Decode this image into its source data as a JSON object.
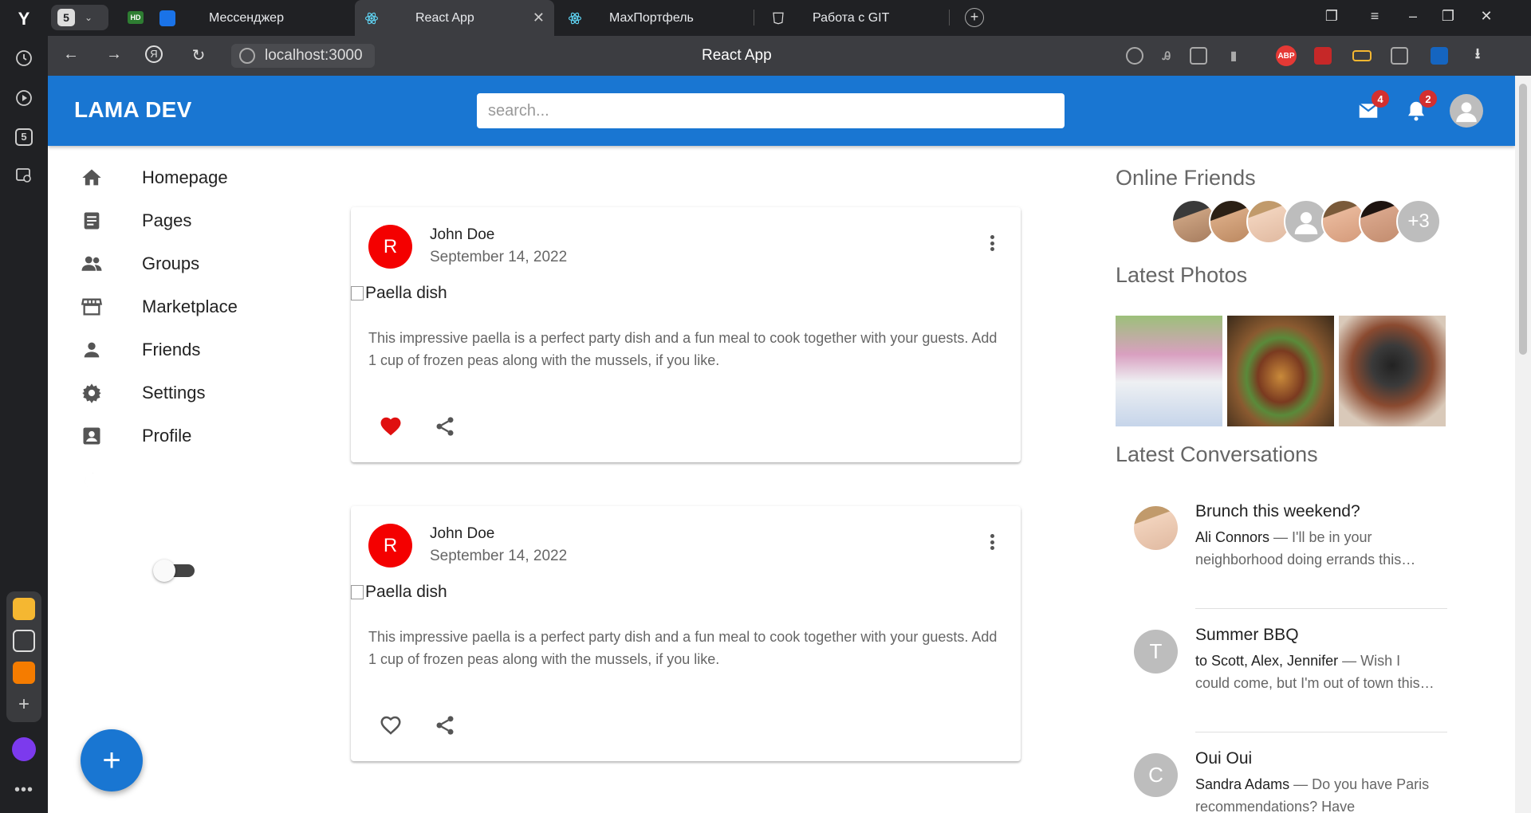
{
  "browser": {
    "rail_logo": "Y",
    "rail_badge": "5",
    "tabs": [
      {
        "label": "Мессенджер"
      },
      {
        "label": "React App",
        "active": true
      },
      {
        "label": "МахПортфель"
      },
      {
        "label": "Работа с GIT"
      }
    ],
    "tab_counter": "5",
    "url": "localhost:3000",
    "page_title": "React App",
    "ext_abp": "ABP"
  },
  "appbar": {
    "brand": "LAMA DEV",
    "search_placeholder": "search...",
    "mail_badge": "4",
    "notif_badge": "2"
  },
  "sidebar": {
    "items": [
      {
        "label": "Homepage",
        "icon": "home-icon"
      },
      {
        "label": "Pages",
        "icon": "article-icon"
      },
      {
        "label": "Groups",
        "icon": "groups-icon"
      },
      {
        "label": "Marketplace",
        "icon": "storefront-icon"
      },
      {
        "label": "Friends",
        "icon": "person-icon"
      },
      {
        "label": "Settings",
        "icon": "settings-icon"
      },
      {
        "label": "Profile",
        "icon": "account-box-icon"
      }
    ],
    "dark_mode_icon": "moon-icon"
  },
  "fab_label": "+",
  "feed": {
    "posts": [
      {
        "avatar_letter": "R",
        "author": "John Doe",
        "date": "September 14, 2022",
        "image_alt": "Paella dish",
        "text": "This impressive paella is a perfect party dish and a fun meal to cook together with your guests. Add 1 cup of frozen peas along with the mussels, if you like.",
        "liked": true
      },
      {
        "avatar_letter": "R",
        "author": "John Doe",
        "date": "September 14, 2022",
        "image_alt": "Paella dish",
        "text": "This impressive paella is a perfect party dish and a fun meal to cook together with your guests. Add 1 cup of frozen peas along with the mussels, if you like.",
        "liked": false
      }
    ]
  },
  "rightbar": {
    "online_title": "Online Friends",
    "online_more": "+3",
    "photos_title": "Latest Photos",
    "conversations_title": "Latest Conversations",
    "conversations": [
      {
        "title": "Brunch this weekend?",
        "who": "Ali Connors",
        "snippet": " — I'll be in your neighborhood doing errands this…",
        "avatar_letter": ""
      },
      {
        "title": "Summer BBQ",
        "who": "to Scott, Alex, Jennifer",
        "snippet": " — Wish I could come, but I'm out of town this…",
        "avatar_letter": "T"
      },
      {
        "title": "Oui Oui",
        "who": "Sandra Adams",
        "snippet": " — Do you have Paris recommendations? Have",
        "avatar_letter": "C"
      }
    ]
  },
  "colors": {
    "primary": "#1976d2",
    "avatar_red": "#f40000",
    "like_red": "#e01010",
    "badge_red": "#d32f2f"
  }
}
